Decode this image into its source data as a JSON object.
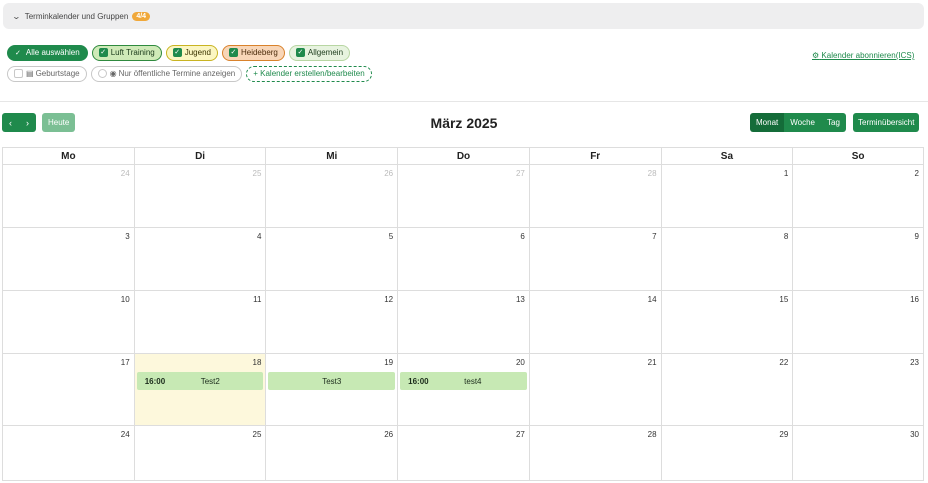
{
  "accordion": {
    "label": "Terminkalender und Gruppen",
    "count": "4/4"
  },
  "filters": {
    "select_all": "Alle auswählen",
    "calendars": [
      {
        "label": "Luft Training",
        "checked": true
      },
      {
        "label": "Jugend",
        "checked": true
      },
      {
        "label": "Heideberg",
        "checked": true
      },
      {
        "label": "Allgemein",
        "checked": true
      }
    ],
    "birthdays": "Geburtstage",
    "public_only": "Nur öffentliche Termine anzeigen",
    "add_calendar": "+ Kalender erstellen/bearbeiten"
  },
  "subscribe": "Kalender abonnieren(ICS)",
  "toolbar": {
    "prev": "‹",
    "next": "›",
    "today": "Heute",
    "title": "März 2025",
    "views": [
      "Monat",
      "Woche",
      "Tag"
    ],
    "active_view": "Monat",
    "overview": "Terminübersicht"
  },
  "calendar": {
    "weekdays": [
      "Mo",
      "Di",
      "Mi",
      "Do",
      "Fr",
      "Sa",
      "So"
    ],
    "weeks": [
      {
        "days": [
          {
            "n": "24",
            "other": true
          },
          {
            "n": "25",
            "other": true
          },
          {
            "n": "26",
            "other": true
          },
          {
            "n": "27",
            "other": true
          },
          {
            "n": "28",
            "other": true
          },
          {
            "n": "1"
          },
          {
            "n": "2"
          }
        ]
      },
      {
        "days": [
          {
            "n": "3"
          },
          {
            "n": "4"
          },
          {
            "n": "5"
          },
          {
            "n": "6"
          },
          {
            "n": "7"
          },
          {
            "n": "8"
          },
          {
            "n": "9"
          }
        ]
      },
      {
        "days": [
          {
            "n": "10"
          },
          {
            "n": "11"
          },
          {
            "n": "12"
          },
          {
            "n": "13"
          },
          {
            "n": "14"
          },
          {
            "n": "15"
          },
          {
            "n": "16"
          }
        ]
      },
      {
        "days": [
          {
            "n": "17"
          },
          {
            "n": "18",
            "today": true,
            "event": {
              "time": "16:00",
              "title": "Test2"
            }
          },
          {
            "n": "19",
            "event": {
              "time": "",
              "title": "Test3"
            }
          },
          {
            "n": "20",
            "event": {
              "time": "16:00",
              "title": "test4"
            }
          },
          {
            "n": "21"
          },
          {
            "n": "22"
          },
          {
            "n": "23"
          }
        ]
      },
      {
        "days": [
          {
            "n": "24"
          },
          {
            "n": "25"
          },
          {
            "n": "26"
          },
          {
            "n": "27"
          },
          {
            "n": "28"
          },
          {
            "n": "29"
          },
          {
            "n": "30"
          }
        ]
      }
    ]
  },
  "colors": {
    "accent": "#1f8a4c",
    "today_bg": "#fdf8dc",
    "event_bg": "#c7e9b4"
  }
}
